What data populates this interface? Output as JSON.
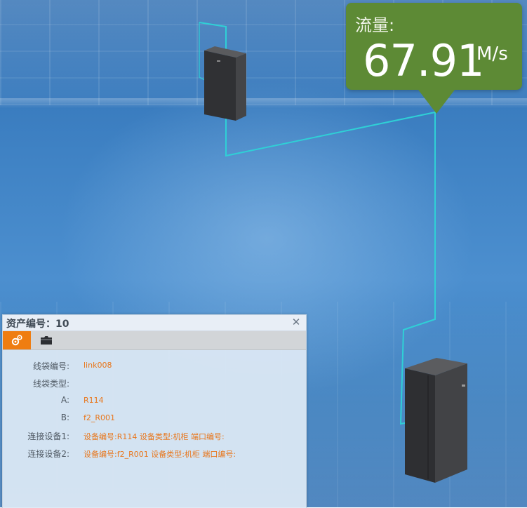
{
  "flow": {
    "label": "流量:",
    "value": "67.91",
    "unit": "M/s",
    "color": "#5d8a35"
  },
  "panel": {
    "title": "资产编号：10",
    "close_icon": "close-icon",
    "tabs": [
      {
        "icon": "gear-icon",
        "active": true,
        "color": "#ef7d11"
      },
      {
        "icon": "folder-icon",
        "active": false
      }
    ],
    "fields": [
      {
        "label": "线袋编号:",
        "value": "link008"
      },
      {
        "label": "线袋类型:",
        "value": ""
      },
      {
        "label": "A:",
        "value": "R114"
      },
      {
        "label": "B:",
        "value": "f2_R001"
      },
      {
        "label": "连接设备1:",
        "value": "设备编号:R114 设备类型:机柜 端口编号:"
      },
      {
        "label": "连接设备2:",
        "value": "设备编号:f2_R001 设备类型:机柜 端口编号:"
      }
    ],
    "value_color": "#e8761b"
  },
  "scene": {
    "cable_color": "#2fd0d6",
    "cabinet_color": "#3a3b3d"
  }
}
